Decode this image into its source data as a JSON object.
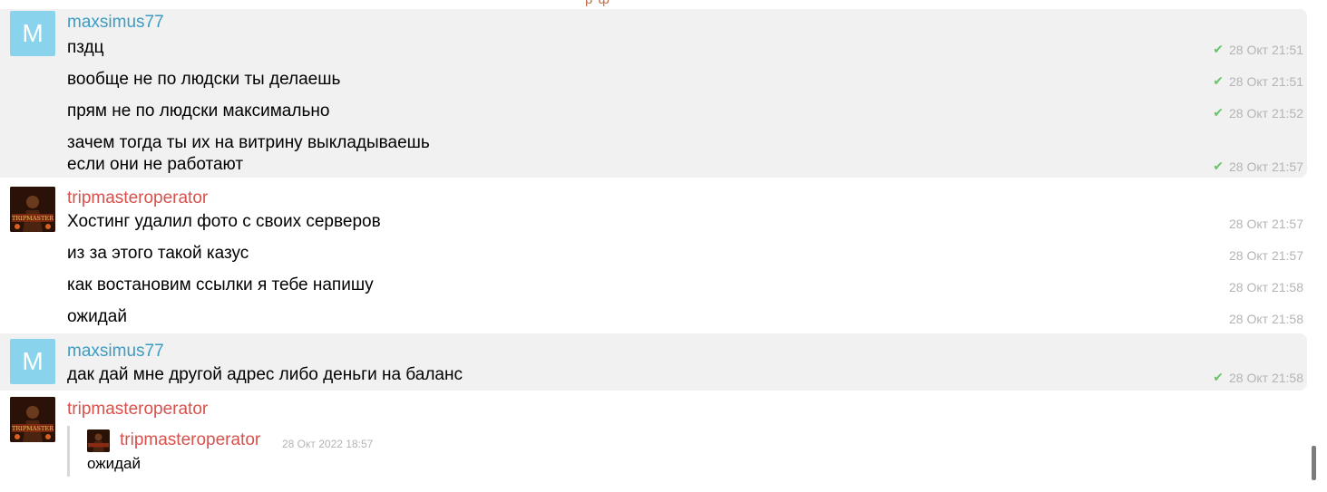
{
  "top_fragment": "р  ф",
  "colors": {
    "own_bg": "#f1f1f1",
    "sender_blue": "#3a9cc4",
    "sender_red": "#d6524c",
    "avatar_letter_bg": "#8ad3ec",
    "read_check": "#6ac36b",
    "timestamp": "#b4b4b4"
  },
  "groups": [
    {
      "sender": "maxsimus77",
      "avatar_letter": "M",
      "messages": [
        {
          "text": "пздц",
          "time": "28 Окт 21:51",
          "read": true
        },
        {
          "text": "вообще не по людски ты делаешь",
          "time": "28 Окт 21:51",
          "read": true
        },
        {
          "text": "прям не по людски максимально",
          "time": "28 Окт 21:52",
          "read": true
        },
        {
          "text": "зачем тогда ты их на витрину выкладываешь",
          "text2": "если они не работают",
          "time": "28 Окт 21:57",
          "read": true
        }
      ]
    },
    {
      "sender": "tripmasteroperator",
      "avatar_text": "TRIPMASTER",
      "messages": [
        {
          "text": "Хостинг удалил фото с своих серверов",
          "time": "28 Окт 21:57"
        },
        {
          "text": "из за этого такой казус",
          "time": "28 Окт 21:57"
        },
        {
          "text": "как востановим ссылки я тебе напишу",
          "time": "28 Окт 21:58"
        },
        {
          "text": "ожидай",
          "time": "28 Окт 21:58"
        }
      ]
    },
    {
      "sender": "maxsimus77",
      "avatar_letter": "M",
      "messages": [
        {
          "text": "дак дай мне другой адрес либо деньги на баланс",
          "time": "28 Окт 21:58",
          "read": true
        }
      ]
    },
    {
      "sender": "tripmasteroperator",
      "avatar_text": "TRIPMASTER",
      "forwarded": {
        "sender": "tripmasteroperator",
        "time": "28 Окт 2022 18:57",
        "text": "ожидай"
      }
    }
  ]
}
